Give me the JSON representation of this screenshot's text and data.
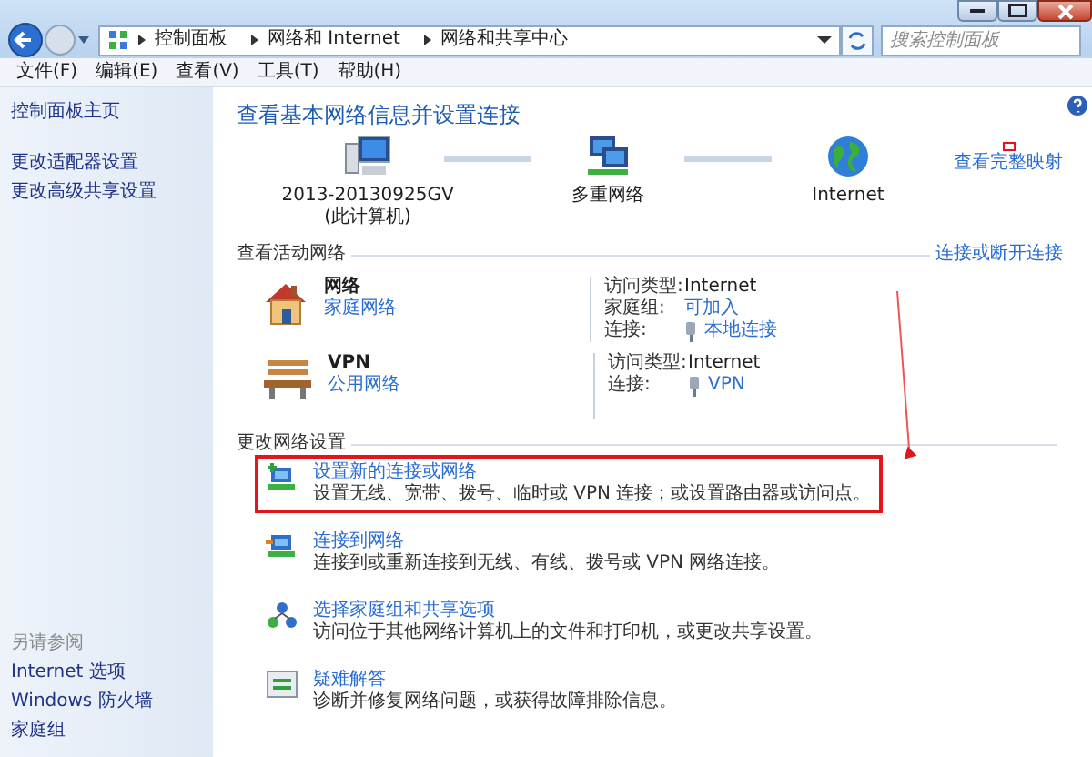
{
  "address_bar": {
    "breadcrumb": [
      "控制面板",
      "网络和 Internet",
      "网络和共享中心"
    ],
    "search": {
      "placeholder": "搜索控制面板"
    }
  },
  "menu_bar": [
    "文件(F)",
    "编辑(E)",
    "查看(V)",
    "工具(T)",
    "帮助(H)"
  ],
  "sidebar": {
    "links": [
      "控制面板主页",
      "更改适配器设置",
      "更改高级共享设置"
    ],
    "see_also": {
      "heading": "另请参阅",
      "links": [
        "Internet 选项",
        "Windows 防火墙",
        "家庭组"
      ]
    }
  },
  "main": {
    "title": "查看基本网络信息并设置连接",
    "map": {
      "nodes": [
        {
          "kind": "computer",
          "label": "2013-20130925GV",
          "sublabel": "(此计算机)"
        },
        {
          "kind": "multi-network",
          "label": "多重网络"
        },
        {
          "kind": "internet",
          "label": "Internet"
        }
      ],
      "full_map_link": {
        "text": "查看完整映射",
        "marked": true
      }
    },
    "active_networks": {
      "heading": "查看活动网络",
      "link": "连接或断开连接",
      "networks": [
        {
          "kind": "home",
          "name": "网络",
          "type": "家庭网络",
          "properties": [
            {
              "kind": "text",
              "label": "访问类型:",
              "value": "Internet"
            },
            {
              "kind": "link",
              "label": "家庭组:",
              "value": "可加入"
            },
            {
              "kind": "connection",
              "label": "连接:",
              "value": "本地连接"
            }
          ]
        },
        {
          "kind": "public",
          "name": "VPN",
          "type": "公用网络",
          "properties": [
            {
              "kind": "text",
              "label": "访问类型:",
              "value": "Internet"
            },
            {
              "kind": "connection",
              "label": "连接:",
              "value": "VPN"
            }
          ]
        }
      ]
    },
    "change_settings": {
      "heading": "更改网络设置",
      "tasks": [
        {
          "kind": "setup",
          "title": "设置新的连接或网络",
          "description": "设置无线、宽带、拨号、临时或 VPN 连接；或设置路由器或访问点。",
          "highlighted": true
        },
        {
          "kind": "connect",
          "title": "连接到网络",
          "description": "连接到或重新连接到无线、有线、拨号或 VPN 网络连接。",
          "highlighted": false
        },
        {
          "kind": "homegroup",
          "title": "选择家庭组和共享选项",
          "description": "访问位于其他网络计算机上的文件和打印机，或更改共享设置。",
          "highlighted": false
        },
        {
          "kind": "troubleshoot",
          "title": "疑难解答",
          "description": "诊断并修复网络问题，或获得故障排除信息。",
          "highlighted": false
        }
      ]
    }
  }
}
